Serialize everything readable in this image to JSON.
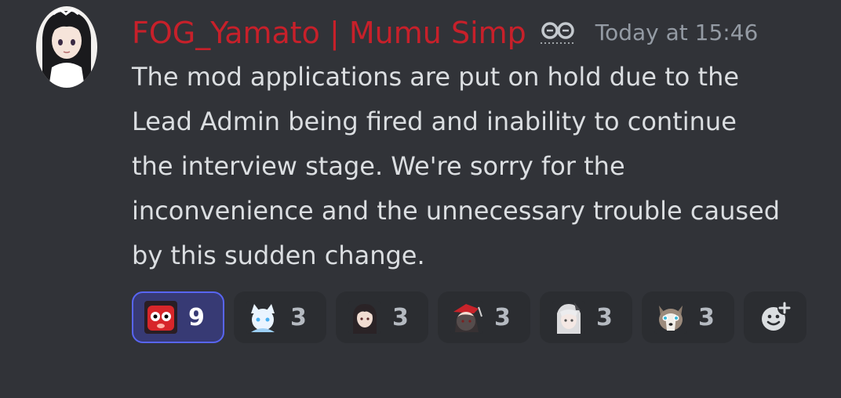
{
  "message": {
    "author": {
      "name": "FOG_Yamato | Mumu Simp",
      "name_color": "#c7202a",
      "badge_icon": "linked-roles-icon",
      "avatar_icon": "anime-girl-avatar"
    },
    "timestamp": "Today at 15:46",
    "content_lines": [
      "The mod applications are put on hold due to the",
      "Lead Admin being fired and inability to continue",
      "the interview stage. We're sorry for the",
      "inconvenience and the unnecessary trouble caused",
      "by this sudden change."
    ]
  },
  "reactions": [
    {
      "emoji": "red-shocked-face-emoji",
      "count": "9",
      "reacted": true
    },
    {
      "emoji": "white-fox-girl-emoji",
      "count": "3",
      "reacted": false
    },
    {
      "emoji": "dark-haired-girl-emoji",
      "count": "3",
      "reacted": false
    },
    {
      "emoji": "red-hat-character-emoji",
      "count": "3",
      "reacted": false
    },
    {
      "emoji": "white-haired-girl-emoji",
      "count": "3",
      "reacted": false
    },
    {
      "emoji": "husky-dog-emoji",
      "count": "3",
      "reacted": false
    }
  ],
  "add_reaction": {
    "icon": "add-reaction-icon"
  },
  "colors": {
    "background": "#313338",
    "text": "#dbdee1",
    "muted": "#949ba4",
    "reaction_bg": "#2b2d31",
    "reacted_bg": "#373a74",
    "reacted_border": "#5865f2"
  }
}
